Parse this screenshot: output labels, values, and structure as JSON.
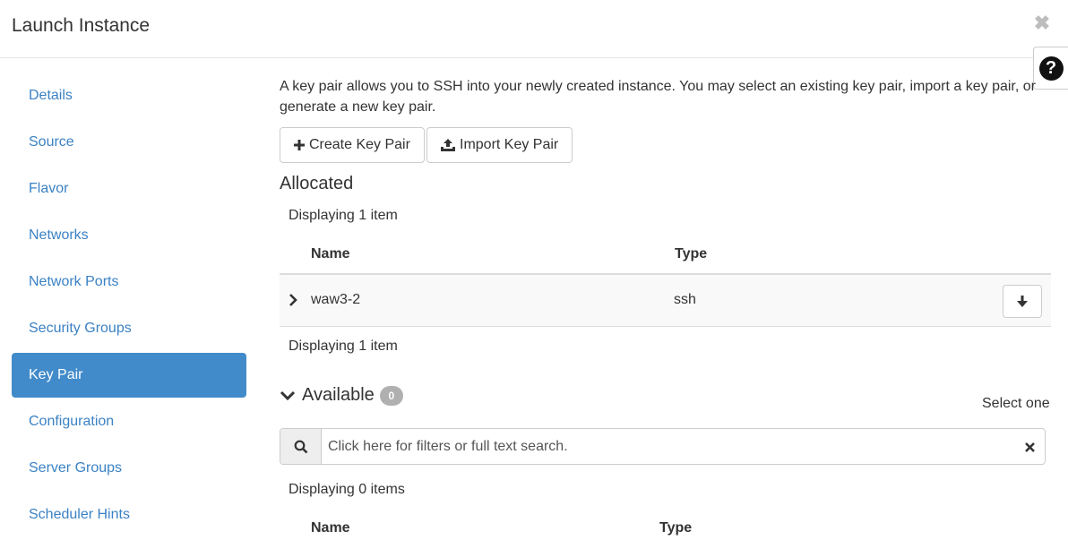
{
  "modal": {
    "title": "Launch Instance",
    "close_icon": "close-icon",
    "help_label": "?"
  },
  "sidebar": {
    "items": [
      {
        "label": "Details",
        "active": false
      },
      {
        "label": "Source",
        "active": false
      },
      {
        "label": "Flavor",
        "active": false
      },
      {
        "label": "Networks",
        "active": false
      },
      {
        "label": "Network Ports",
        "active": false
      },
      {
        "label": "Security Groups",
        "active": false
      },
      {
        "label": "Key Pair",
        "active": true
      },
      {
        "label": "Configuration",
        "active": false
      },
      {
        "label": "Server Groups",
        "active": false
      },
      {
        "label": "Scheduler Hints",
        "active": false
      }
    ]
  },
  "main": {
    "intro": "A key pair allows you to SSH into your newly created instance. You may select an existing key pair, import a key pair, or generate a new key pair.",
    "create_button": "Create Key Pair",
    "import_button": "Import Key Pair",
    "allocated": {
      "title": "Allocated",
      "count_top": "Displaying 1 item",
      "columns": [
        "Name",
        "Type"
      ],
      "rows": [
        {
          "name": "waw3-2",
          "type": "ssh"
        }
      ],
      "count_bottom": "Displaying 1 item"
    },
    "available": {
      "title": "Available",
      "badge": "0",
      "select_hint": "Select one",
      "search_placeholder": "Click here for filters or full text search.",
      "count": "Displaying 0 items",
      "columns": [
        "Name",
        "Type"
      ]
    }
  },
  "colors": {
    "accent": "#428bca",
    "link": "#3b82c4",
    "badge": "#b0b0b0"
  }
}
